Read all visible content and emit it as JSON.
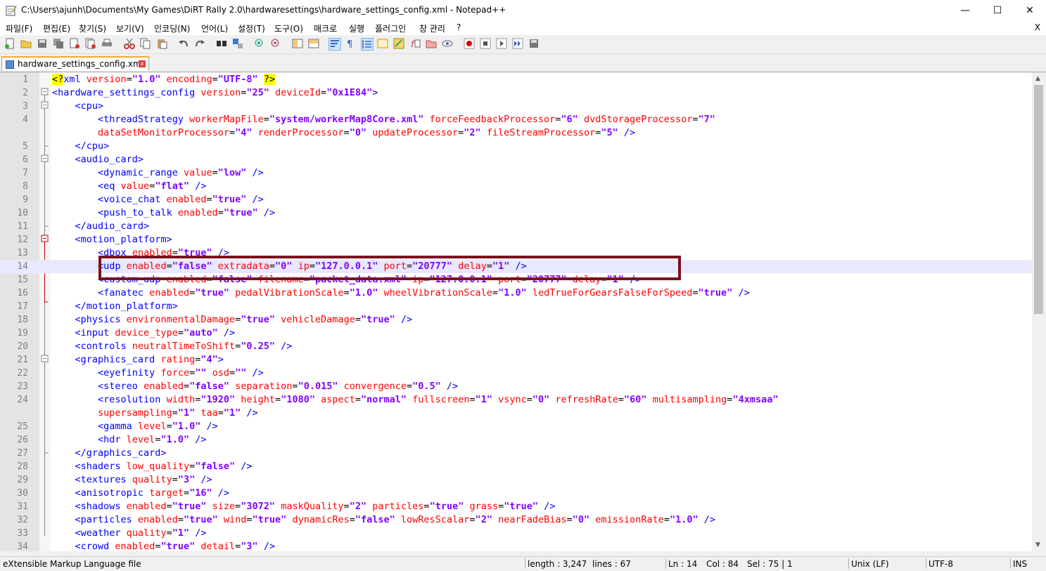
{
  "window": {
    "title": "C:\\Users\\ajunh\\Documents\\My Games\\DiRT Rally 2.0\\hardwaresettings\\hardware_settings_config.xml - Notepad++",
    "minimize": "—",
    "maximize": "☐",
    "close": "✕"
  },
  "menu": {
    "items": [
      "파일(F)",
      "편집(E)",
      "찾기(S)",
      "보기(V)",
      "인코딩(N)",
      "언어(L)",
      "설정(T)",
      "도구(O)",
      "매크로",
      "실행",
      "플러그인",
      "창 관리",
      "?"
    ],
    "close": "X"
  },
  "tab": {
    "label": "hardware_settings_config.xml",
    "close": "x"
  },
  "editor": {
    "lines": [
      {
        "n": "1"
      },
      {
        "n": "2"
      },
      {
        "n": "3"
      },
      {
        "n": "4"
      },
      {
        "n": ""
      },
      {
        "n": "5"
      },
      {
        "n": "6"
      },
      {
        "n": "7"
      },
      {
        "n": "8"
      },
      {
        "n": "9"
      },
      {
        "n": "10"
      },
      {
        "n": "11"
      },
      {
        "n": "12"
      },
      {
        "n": "13"
      },
      {
        "n": "14"
      },
      {
        "n": "15"
      },
      {
        "n": "16"
      },
      {
        "n": "17"
      },
      {
        "n": "18"
      },
      {
        "n": "19"
      },
      {
        "n": "20"
      },
      {
        "n": "21"
      },
      {
        "n": "22"
      },
      {
        "n": "23"
      },
      {
        "n": "24"
      },
      {
        "n": ""
      },
      {
        "n": "25"
      },
      {
        "n": "26"
      },
      {
        "n": "27"
      },
      {
        "n": "28"
      },
      {
        "n": "29"
      },
      {
        "n": "30"
      },
      {
        "n": "31"
      },
      {
        "n": "32"
      },
      {
        "n": "33"
      },
      {
        "n": "34"
      }
    ],
    "code": [
      [
        [
          "hl",
          "<?"
        ],
        [
          "t",
          "xml "
        ],
        [
          "a",
          "version"
        ],
        [
          "n",
          "="
        ],
        [
          "v",
          "\"1.0\""
        ],
        [
          "a",
          " encoding"
        ],
        [
          "n",
          "="
        ],
        [
          "v",
          "\"UTF-8\""
        ],
        [
          "n",
          " "
        ],
        [
          "hl",
          "?>"
        ]
      ],
      [
        [
          "t",
          "<hardware_settings_config "
        ],
        [
          "a",
          "version"
        ],
        [
          "n",
          "="
        ],
        [
          "v",
          "\"25\""
        ],
        [
          "a",
          " deviceId"
        ],
        [
          "n",
          "="
        ],
        [
          "v",
          "\"0x1E84\""
        ],
        [
          "t",
          ">"
        ]
      ],
      [
        [
          "n",
          "    "
        ],
        [
          "t",
          "<cpu>"
        ]
      ],
      [
        [
          "n",
          "        "
        ],
        [
          "t",
          "<threadStrategy "
        ],
        [
          "a",
          "workerMapFile"
        ],
        [
          "n",
          "="
        ],
        [
          "v",
          "\"system/workerMap8Core.xml\""
        ],
        [
          "a",
          " forceFeedbackProcessor"
        ],
        [
          "n",
          "="
        ],
        [
          "v",
          "\"6\""
        ],
        [
          "a",
          " dvdStorageProcessor"
        ],
        [
          "n",
          "="
        ],
        [
          "v",
          "\"7\""
        ]
      ],
      [
        [
          "n",
          "        "
        ],
        [
          "a",
          "dataSetMonitorProcessor"
        ],
        [
          "n",
          "="
        ],
        [
          "v",
          "\"4\""
        ],
        [
          "a",
          " renderProcessor"
        ],
        [
          "n",
          "="
        ],
        [
          "v",
          "\"0\""
        ],
        [
          "a",
          " updateProcessor"
        ],
        [
          "n",
          "="
        ],
        [
          "v",
          "\"2\""
        ],
        [
          "a",
          " fileStreamProcessor"
        ],
        [
          "n",
          "="
        ],
        [
          "v",
          "\"5\""
        ],
        [
          "t",
          " />"
        ]
      ],
      [
        [
          "n",
          "    "
        ],
        [
          "t",
          "</cpu>"
        ]
      ],
      [
        [
          "n",
          "    "
        ],
        [
          "t",
          "<audio_card>"
        ]
      ],
      [
        [
          "n",
          "        "
        ],
        [
          "t",
          "<dynamic_range "
        ],
        [
          "a",
          "value"
        ],
        [
          "n",
          "="
        ],
        [
          "v",
          "\"low\""
        ],
        [
          "t",
          " />"
        ]
      ],
      [
        [
          "n",
          "        "
        ],
        [
          "t",
          "<eq "
        ],
        [
          "a",
          "value"
        ],
        [
          "n",
          "="
        ],
        [
          "v",
          "\"flat\""
        ],
        [
          "t",
          " />"
        ]
      ],
      [
        [
          "n",
          "        "
        ],
        [
          "t",
          "<voice_chat "
        ],
        [
          "a",
          "enabled"
        ],
        [
          "n",
          "="
        ],
        [
          "v",
          "\"true\""
        ],
        [
          "t",
          " />"
        ]
      ],
      [
        [
          "n",
          "        "
        ],
        [
          "t",
          "<push_to_talk "
        ],
        [
          "a",
          "enabled"
        ],
        [
          "n",
          "="
        ],
        [
          "v",
          "\"true\""
        ],
        [
          "t",
          " />"
        ]
      ],
      [
        [
          "n",
          "    "
        ],
        [
          "t",
          "</audio_card>"
        ]
      ],
      [
        [
          "n",
          "    "
        ],
        [
          "t",
          "<motion_platform>"
        ]
      ],
      [
        [
          "n",
          "        "
        ],
        [
          "t",
          "<dbox "
        ],
        [
          "a",
          "enabled"
        ],
        [
          "n",
          "="
        ],
        [
          "v",
          "\"true\""
        ],
        [
          "t",
          " />"
        ]
      ],
      [
        [
          "n",
          "        "
        ],
        [
          "t",
          "<udp "
        ],
        [
          "a",
          "enabled"
        ],
        [
          "n",
          "="
        ],
        [
          "v",
          "\"false\""
        ],
        [
          "a",
          " extradata"
        ],
        [
          "n",
          "="
        ],
        [
          "v",
          "\"0\""
        ],
        [
          "a",
          " ip"
        ],
        [
          "n",
          "="
        ],
        [
          "v",
          "\"127.0.0.1\""
        ],
        [
          "a",
          " port"
        ],
        [
          "n",
          "="
        ],
        [
          "v",
          "\"20777\""
        ],
        [
          "a",
          " delay"
        ],
        [
          "n",
          "="
        ],
        [
          "v",
          "\"1\""
        ],
        [
          "t",
          " />"
        ]
      ],
      [
        [
          "n",
          "        "
        ],
        [
          "t",
          "<custom_udp "
        ],
        [
          "a",
          "enabled"
        ],
        [
          "n",
          "="
        ],
        [
          "v",
          "\"false\""
        ],
        [
          "a",
          " filename"
        ],
        [
          "n",
          "="
        ],
        [
          "v",
          "\"packet_data.xml\""
        ],
        [
          "a",
          " ip"
        ],
        [
          "n",
          "="
        ],
        [
          "v",
          "\"127.0.0.1\""
        ],
        [
          "a",
          " port"
        ],
        [
          "n",
          "="
        ],
        [
          "v",
          "\"20777\""
        ],
        [
          "a",
          " delay"
        ],
        [
          "n",
          "="
        ],
        [
          "v",
          "\"1\""
        ],
        [
          "t",
          " />"
        ]
      ],
      [
        [
          "n",
          "        "
        ],
        [
          "t",
          "<fanatec "
        ],
        [
          "a",
          "enabled"
        ],
        [
          "n",
          "="
        ],
        [
          "v",
          "\"true\""
        ],
        [
          "a",
          " pedalVibrationScale"
        ],
        [
          "n",
          "="
        ],
        [
          "v",
          "\"1.0\""
        ],
        [
          "a",
          " wheelVibrationScale"
        ],
        [
          "n",
          "="
        ],
        [
          "v",
          "\"1.0\""
        ],
        [
          "a",
          " ledTrueForGearsFalseForSpeed"
        ],
        [
          "n",
          "="
        ],
        [
          "v",
          "\"true\""
        ],
        [
          "t",
          " />"
        ]
      ],
      [
        [
          "n",
          "    "
        ],
        [
          "t",
          "</motion_platform>"
        ]
      ],
      [
        [
          "n",
          "    "
        ],
        [
          "t",
          "<physics "
        ],
        [
          "a",
          "environmentalDamage"
        ],
        [
          "n",
          "="
        ],
        [
          "v",
          "\"true\""
        ],
        [
          "a",
          " vehicleDamage"
        ],
        [
          "n",
          "="
        ],
        [
          "v",
          "\"true\""
        ],
        [
          "t",
          " />"
        ]
      ],
      [
        [
          "n",
          "    "
        ],
        [
          "t",
          "<input "
        ],
        [
          "a",
          "device_type"
        ],
        [
          "n",
          "="
        ],
        [
          "v",
          "\"auto\""
        ],
        [
          "t",
          " />"
        ]
      ],
      [
        [
          "n",
          "    "
        ],
        [
          "t",
          "<controls "
        ],
        [
          "a",
          "neutralTimeToShift"
        ],
        [
          "n",
          "="
        ],
        [
          "v",
          "\"0.25\""
        ],
        [
          "t",
          " />"
        ]
      ],
      [
        [
          "n",
          "    "
        ],
        [
          "t",
          "<graphics_card "
        ],
        [
          "a",
          "rating"
        ],
        [
          "n",
          "="
        ],
        [
          "v",
          "\"4\""
        ],
        [
          "t",
          ">"
        ]
      ],
      [
        [
          "n",
          "        "
        ],
        [
          "t",
          "<eyefinity "
        ],
        [
          "a",
          "force"
        ],
        [
          "n",
          "="
        ],
        [
          "v",
          "\"\""
        ],
        [
          "a",
          " osd"
        ],
        [
          "n",
          "="
        ],
        [
          "v",
          "\"\""
        ],
        [
          "t",
          " />"
        ]
      ],
      [
        [
          "n",
          "        "
        ],
        [
          "t",
          "<stereo "
        ],
        [
          "a",
          "enabled"
        ],
        [
          "n",
          "="
        ],
        [
          "v",
          "\"false\""
        ],
        [
          "a",
          " separation"
        ],
        [
          "n",
          "="
        ],
        [
          "v",
          "\"0.015\""
        ],
        [
          "a",
          " convergence"
        ],
        [
          "n",
          "="
        ],
        [
          "v",
          "\"0.5\""
        ],
        [
          "t",
          " />"
        ]
      ],
      [
        [
          "n",
          "        "
        ],
        [
          "t",
          "<resolution "
        ],
        [
          "a",
          "width"
        ],
        [
          "n",
          "="
        ],
        [
          "v",
          "\"1920\""
        ],
        [
          "a",
          " height"
        ],
        [
          "n",
          "="
        ],
        [
          "v",
          "\"1080\""
        ],
        [
          "a",
          " aspect"
        ],
        [
          "n",
          "="
        ],
        [
          "v",
          "\"normal\""
        ],
        [
          "a",
          " fullscreen"
        ],
        [
          "n",
          "="
        ],
        [
          "v",
          "\"1\""
        ],
        [
          "a",
          " vsync"
        ],
        [
          "n",
          "="
        ],
        [
          "v",
          "\"0\""
        ],
        [
          "a",
          " refreshRate"
        ],
        [
          "n",
          "="
        ],
        [
          "v",
          "\"60\""
        ],
        [
          "a",
          " multisampling"
        ],
        [
          "n",
          "="
        ],
        [
          "v",
          "\"4xmsaa\""
        ]
      ],
      [
        [
          "n",
          "        "
        ],
        [
          "a",
          "supersampling"
        ],
        [
          "n",
          "="
        ],
        [
          "v",
          "\"1\""
        ],
        [
          "a",
          " taa"
        ],
        [
          "n",
          "="
        ],
        [
          "v",
          "\"1\""
        ],
        [
          "t",
          " />"
        ]
      ],
      [
        [
          "n",
          "        "
        ],
        [
          "t",
          "<gamma "
        ],
        [
          "a",
          "level"
        ],
        [
          "n",
          "="
        ],
        [
          "v",
          "\"1.0\""
        ],
        [
          "t",
          " />"
        ]
      ],
      [
        [
          "n",
          "        "
        ],
        [
          "t",
          "<hdr "
        ],
        [
          "a",
          "level"
        ],
        [
          "n",
          "="
        ],
        [
          "v",
          "\"1.0\""
        ],
        [
          "t",
          " />"
        ]
      ],
      [
        [
          "n",
          "    "
        ],
        [
          "t",
          "</graphics_card>"
        ]
      ],
      [
        [
          "n",
          "    "
        ],
        [
          "t",
          "<shaders "
        ],
        [
          "a",
          "low_quality"
        ],
        [
          "n",
          "="
        ],
        [
          "v",
          "\"false\""
        ],
        [
          "t",
          " />"
        ]
      ],
      [
        [
          "n",
          "    "
        ],
        [
          "t",
          "<textures "
        ],
        [
          "a",
          "quality"
        ],
        [
          "n",
          "="
        ],
        [
          "v",
          "\"3\""
        ],
        [
          "t",
          " />"
        ]
      ],
      [
        [
          "n",
          "    "
        ],
        [
          "t",
          "<anisotropic "
        ],
        [
          "a",
          "target"
        ],
        [
          "n",
          "="
        ],
        [
          "v",
          "\"16\""
        ],
        [
          "t",
          " />"
        ]
      ],
      [
        [
          "n",
          "    "
        ],
        [
          "t",
          "<shadows "
        ],
        [
          "a",
          "enabled"
        ],
        [
          "n",
          "="
        ],
        [
          "v",
          "\"true\""
        ],
        [
          "a",
          " size"
        ],
        [
          "n",
          "="
        ],
        [
          "v",
          "\"3072\""
        ],
        [
          "a",
          " maskQuality"
        ],
        [
          "n",
          "="
        ],
        [
          "v",
          "\"2\""
        ],
        [
          "a",
          " particles"
        ],
        [
          "n",
          "="
        ],
        [
          "v",
          "\"true\""
        ],
        [
          "a",
          " grass"
        ],
        [
          "n",
          "="
        ],
        [
          "v",
          "\"true\""
        ],
        [
          "t",
          " />"
        ]
      ],
      [
        [
          "n",
          "    "
        ],
        [
          "t",
          "<particles "
        ],
        [
          "a",
          "enabled"
        ],
        [
          "n",
          "="
        ],
        [
          "v",
          "\"true\""
        ],
        [
          "a",
          " wind"
        ],
        [
          "n",
          "="
        ],
        [
          "v",
          "\"true\""
        ],
        [
          "a",
          " dynamicRes"
        ],
        [
          "n",
          "="
        ],
        [
          "v",
          "\"false\""
        ],
        [
          "a",
          " lowResScalar"
        ],
        [
          "n",
          "="
        ],
        [
          "v",
          "\"2\""
        ],
        [
          "a",
          " nearFadeBias"
        ],
        [
          "n",
          "="
        ],
        [
          "v",
          "\"0\""
        ],
        [
          "a",
          " emissionRate"
        ],
        [
          "n",
          "="
        ],
        [
          "v",
          "\"1.0\""
        ],
        [
          "t",
          " />"
        ]
      ],
      [
        [
          "n",
          "    "
        ],
        [
          "t",
          "<weather "
        ],
        [
          "a",
          "quality"
        ],
        [
          "n",
          "="
        ],
        [
          "v",
          "\"1\""
        ],
        [
          "t",
          " />"
        ]
      ],
      [
        [
          "n",
          "    "
        ],
        [
          "t",
          "<crowd "
        ],
        [
          "a",
          "enabled"
        ],
        [
          "n",
          "="
        ],
        [
          "v",
          "\"true\""
        ],
        [
          "a",
          " detail"
        ],
        [
          "n",
          "="
        ],
        [
          "v",
          "\"3\""
        ],
        [
          "t",
          " />"
        ]
      ]
    ]
  },
  "status": {
    "file_type": "eXtensible Markup Language file",
    "length": "length : 3,247",
    "lines": "lines : 67",
    "ln": "Ln : 14",
    "col": "Col : 84",
    "sel": "Sel : 75 | 1",
    "eol": "Unix (LF)",
    "encoding": "UTF-8",
    "mode": "INS"
  },
  "colors": {
    "tag": "#0000ff",
    "attr": "#ff0000",
    "value": "#8000ff",
    "highlight_box": "#7a1320",
    "current_line": "#e8e8ff"
  }
}
